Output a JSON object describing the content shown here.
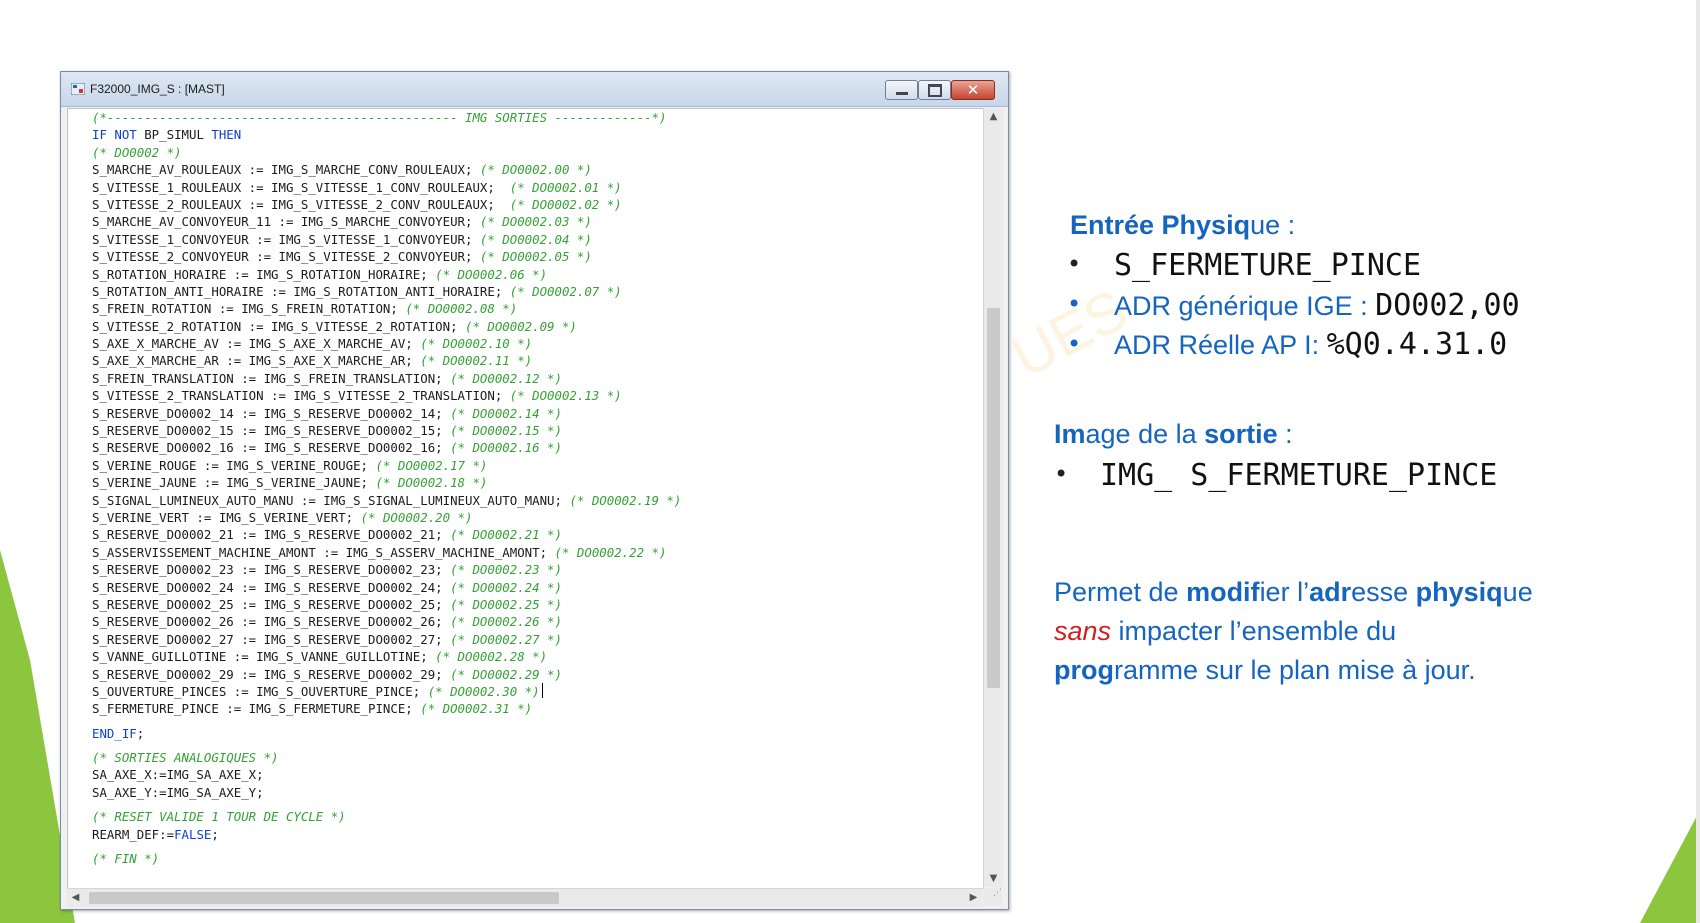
{
  "window": {
    "title": "F32000_IMG_S : [MAST]",
    "icon": "program-section-icon",
    "buttons": {
      "minimize": "minimize-icon",
      "maximize": "maximize-icon",
      "close": "close-icon"
    }
  },
  "code_lines": [
    {
      "parts": [
        {
          "t": "(*----------------------------------------------- IMG SORTIES -------------*)",
          "c": "cm"
        }
      ]
    },
    {
      "parts": [
        {
          "t": "IF NOT",
          "c": "kw"
        },
        {
          "t": " BP_SIMUL ",
          "c": ""
        },
        {
          "t": "THEN",
          "c": "kw"
        }
      ]
    },
    {
      "parts": [
        {
          "t": "(* DO0002 *)",
          "c": "cm"
        }
      ]
    },
    {
      "parts": [
        {
          "t": "S_MARCHE_AV_ROULEAUX := IMG_S_MARCHE_CONV_ROULEAUX; ",
          "c": ""
        },
        {
          "t": "(* DO0002.00 *)",
          "c": "cm"
        }
      ]
    },
    {
      "parts": [
        {
          "t": "S_VITESSE_1_ROULEAUX := IMG_S_VITESSE_1_CONV_ROULEAUX;  ",
          "c": ""
        },
        {
          "t": "(* DO0002.01 *)",
          "c": "cm"
        }
      ]
    },
    {
      "parts": [
        {
          "t": "S_VITESSE_2_ROULEAUX := IMG_S_VITESSE_2_CONV_ROULEAUX;  ",
          "c": ""
        },
        {
          "t": "(* DO0002.02 *)",
          "c": "cm"
        }
      ]
    },
    {
      "parts": [
        {
          "t": "S_MARCHE_AV_CONVOYEUR_11 := IMG_S_MARCHE_CONVOYEUR; ",
          "c": ""
        },
        {
          "t": "(* DO0002.03 *)",
          "c": "cm"
        }
      ]
    },
    {
      "parts": [
        {
          "t": "S_VITESSE_1_CONVOYEUR := IMG_S_VITESSE_1_CONVOYEUR; ",
          "c": ""
        },
        {
          "t": "(* DO0002.04 *)",
          "c": "cm"
        }
      ]
    },
    {
      "parts": [
        {
          "t": "S_VITESSE_2_CONVOYEUR := IMG_S_VITESSE_2_CONVOYEUR; ",
          "c": ""
        },
        {
          "t": "(* DO0002.05 *)",
          "c": "cm"
        }
      ]
    },
    {
      "parts": [
        {
          "t": "S_ROTATION_HORAIRE := IMG_S_ROTATION_HORAIRE; ",
          "c": ""
        },
        {
          "t": "(* DO0002.06 *)",
          "c": "cm"
        }
      ]
    },
    {
      "parts": [
        {
          "t": "S_ROTATION_ANTI_HORAIRE := IMG_S_ROTATION_ANTI_HORAIRE; ",
          "c": ""
        },
        {
          "t": "(* DO0002.07 *)",
          "c": "cm"
        }
      ]
    },
    {
      "parts": [
        {
          "t": "S_FREIN_ROTATION := IMG_S_FREIN_ROTATION; ",
          "c": ""
        },
        {
          "t": "(* DO0002.08 *)",
          "c": "cm"
        }
      ]
    },
    {
      "parts": [
        {
          "t": "S_VITESSE_2_ROTATION := IMG_S_VITESSE_2_ROTATION; ",
          "c": ""
        },
        {
          "t": "(* DO0002.09 *)",
          "c": "cm"
        }
      ]
    },
    {
      "parts": [
        {
          "t": "S_AXE_X_MARCHE_AV := IMG_S_AXE_X_MARCHE_AV; ",
          "c": ""
        },
        {
          "t": "(* DO0002.10 *)",
          "c": "cm"
        }
      ]
    },
    {
      "parts": [
        {
          "t": "S_AXE_X_MARCHE_AR := IMG_S_AXE_X_MARCHE_AR; ",
          "c": ""
        },
        {
          "t": "(* DO0002.11 *)",
          "c": "cm"
        }
      ]
    },
    {
      "parts": [
        {
          "t": "S_FREIN_TRANSLATION := IMG_S_FREIN_TRANSLATION; ",
          "c": ""
        },
        {
          "t": "(* DO0002.12 *)",
          "c": "cm"
        }
      ]
    },
    {
      "parts": [
        {
          "t": "S_VITESSE_2_TRANSLATION := IMG_S_VITESSE_2_TRANSLATION; ",
          "c": ""
        },
        {
          "t": "(* DO0002.13 *)",
          "c": "cm"
        }
      ]
    },
    {
      "parts": [
        {
          "t": "S_RESERVE_DO0002_14 := IMG_S_RESERVE_DO0002_14; ",
          "c": ""
        },
        {
          "t": "(* DO0002.14 *)",
          "c": "cm"
        }
      ]
    },
    {
      "parts": [
        {
          "t": "S_RESERVE_DO0002_15 := IMG_S_RESERVE_DO0002_15; ",
          "c": ""
        },
        {
          "t": "(* DO0002.15 *)",
          "c": "cm"
        }
      ]
    },
    {
      "parts": [
        {
          "t": "S_RESERVE_DO0002_16 := IMG_S_RESERVE_DO0002_16; ",
          "c": ""
        },
        {
          "t": "(* DO0002.16 *)",
          "c": "cm"
        }
      ]
    },
    {
      "parts": [
        {
          "t": "S_VERINE_ROUGE := IMG_S_VERINE_ROUGE; ",
          "c": ""
        },
        {
          "t": "(* DO0002.17 *)",
          "c": "cm"
        }
      ]
    },
    {
      "parts": [
        {
          "t": "S_VERINE_JAUNE := IMG_S_VERINE_JAUNE; ",
          "c": ""
        },
        {
          "t": "(* DO0002.18 *)",
          "c": "cm"
        }
      ]
    },
    {
      "parts": [
        {
          "t": "S_SIGNAL_LUMINEUX_AUTO_MANU := IMG_S_SIGNAL_LUMINEUX_AUTO_MANU; ",
          "c": ""
        },
        {
          "t": "(* DO0002.19 *)",
          "c": "cm"
        }
      ]
    },
    {
      "parts": [
        {
          "t": "S_VERINE_VERT := IMG_S_VERINE_VERT; ",
          "c": ""
        },
        {
          "t": "(* DO0002.20 *)",
          "c": "cm"
        }
      ]
    },
    {
      "parts": [
        {
          "t": "S_RESERVE_DO0002_21 := IMG_S_RESERVE_DO0002_21; ",
          "c": ""
        },
        {
          "t": "(* DO0002.21 *)",
          "c": "cm"
        }
      ]
    },
    {
      "parts": [
        {
          "t": "S_ASSERVISSEMENT_MACHINE_AMONT := IMG_S_ASSERV_MACHINE_AMONT; ",
          "c": ""
        },
        {
          "t": "(* DO0002.22 *)",
          "c": "cm"
        }
      ]
    },
    {
      "parts": [
        {
          "t": "S_RESERVE_DO0002_23 := IMG_S_RESERVE_DO0002_23; ",
          "c": ""
        },
        {
          "t": "(* DO0002.23 *)",
          "c": "cm"
        }
      ]
    },
    {
      "parts": [
        {
          "t": "S_RESERVE_DO0002_24 := IMG_S_RESERVE_DO0002_24; ",
          "c": ""
        },
        {
          "t": "(* DO0002.24 *)",
          "c": "cm"
        }
      ]
    },
    {
      "parts": [
        {
          "t": "S_RESERVE_DO0002_25 := IMG_S_RESERVE_DO0002_25; ",
          "c": ""
        },
        {
          "t": "(* DO0002.25 *)",
          "c": "cm"
        }
      ]
    },
    {
      "parts": [
        {
          "t": "S_RESERVE_DO0002_26 := IMG_S_RESERVE_DO0002_26; ",
          "c": ""
        },
        {
          "t": "(* DO0002.26 *)",
          "c": "cm"
        }
      ]
    },
    {
      "parts": [
        {
          "t": "S_RESERVE_DO0002_27 := IMG_S_RESERVE_DO0002_27; ",
          "c": ""
        },
        {
          "t": "(* DO0002.27 *)",
          "c": "cm"
        }
      ]
    },
    {
      "parts": [
        {
          "t": "S_VANNE_GUILLOTINE := IMG_S_VANNE_GUILLOTINE; ",
          "c": ""
        },
        {
          "t": "(* DO0002.28 *)",
          "c": "cm"
        }
      ]
    },
    {
      "parts": [
        {
          "t": "S_RESERVE_DO0002_29 := IMG_S_RESERVE_DO0002_29; ",
          "c": ""
        },
        {
          "t": "(* DO0002.29 *)",
          "c": "cm"
        }
      ]
    },
    {
      "parts": [
        {
          "t": "S_OUVERTURE_PINCES := IMG_S_OUVERTURE_PINCE; ",
          "c": ""
        },
        {
          "t": "(* DO0002.30 *)",
          "c": "cm"
        }
      ],
      "caret": true
    },
    {
      "parts": [
        {
          "t": "S_FERMETURE_PINCE := IMG_S_FERMETURE_PINCE; ",
          "c": ""
        },
        {
          "t": "(* DO0002.31 *)",
          "c": "cm"
        }
      ]
    },
    {
      "gap": true
    },
    {
      "parts": [
        {
          "t": "END_IF",
          "c": "kw"
        },
        {
          "t": ";",
          "c": ""
        }
      ]
    },
    {
      "gap": true
    },
    {
      "parts": [
        {
          "t": "(* SORTIES ANALOGIQUES *)",
          "c": "cm"
        }
      ]
    },
    {
      "parts": [
        {
          "t": "SA_AXE_X:=IMG_SA_AXE_X;",
          "c": ""
        }
      ]
    },
    {
      "parts": [
        {
          "t": "SA_AXE_Y:=IMG_SA_AXE_Y;",
          "c": ""
        }
      ]
    },
    {
      "gap": true
    },
    {
      "parts": [
        {
          "t": "(* RESET VALIDE 1 TOUR DE CYCLE *)",
          "c": "cm"
        }
      ]
    },
    {
      "parts": [
        {
          "t": "REARM_DEF:=",
          "c": ""
        },
        {
          "t": "FALSE",
          "c": "kw"
        },
        {
          "t": ";",
          "c": ""
        }
      ]
    },
    {
      "gap": true
    },
    {
      "parts": [
        {
          "t": "(* FIN *)",
          "c": "cm"
        }
      ]
    }
  ],
  "scroll": {
    "vertical_fraction": 0.5,
    "horizontal_fraction": 0.0
  },
  "panel": {
    "entree_heading": {
      "p1": "Entrée Physiq",
      "p2": "ue :"
    },
    "bullet_glyph": "•",
    "entree_name": "S_FERMETURE_PINCE",
    "adr_generique_label": "ADR générique IGE : ",
    "adr_generique_value": "DO002,00",
    "adr_reelle_label": "ADR Réelle AP I: ",
    "adr_reelle_value": "%Q0.4.31.0",
    "image_heading": {
      "p1": "Im",
      "p2": "age de la ",
      "p3": "sortie",
      "p4": " :"
    },
    "image_name": "IMG_ S_FERMETURE_PINCE",
    "desc_line1": {
      "a": "Permet de ",
      "b": "modif",
      "c": "ier l’",
      "d": "adr",
      "e": "esse ",
      "f": "physiq",
      "g": "ue"
    },
    "desc_line2": {
      "a": "sans",
      "b": " impacter l’ensemble du"
    },
    "desc_line3": {
      "a": "prog",
      "b": "ramme sur le plan mise à jour."
    },
    "watermark": "UES"
  },
  "colors": {
    "heading_blue": "#1565c0",
    "accent_green": "#8cc63f",
    "keyword_blue": "#0b3fd6",
    "comment_green": "#35a135",
    "emphasis_red": "#d22020"
  }
}
